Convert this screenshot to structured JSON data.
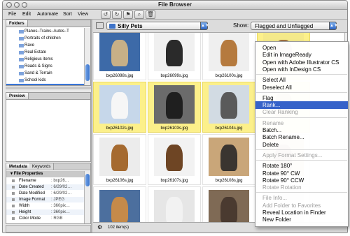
{
  "window": {
    "title": "File Browser"
  },
  "menu": {
    "items": [
      "File",
      "Edit",
      "Automate",
      "Sort",
      "View"
    ]
  },
  "toolbar": {
    "rotate_ccw": "↺",
    "rotate_cw": "↻",
    "flag": "⚑",
    "search": "⌕",
    "delete": "🗑"
  },
  "location": {
    "current_folder": "Silly Pets",
    "show_label": "Show:",
    "show_value": "Flagged and Unflagged"
  },
  "panels": {
    "folders_tab": "Folders",
    "preview_tab": "Preview",
    "metadata_tab": "Metadata",
    "keywords_tab": "Keywords"
  },
  "folder_tree": [
    {
      "label": "Planes–Trains–Autos–T",
      "selected": false
    },
    {
      "label": "Portraits of children",
      "selected": false
    },
    {
      "label": "Rave",
      "selected": false
    },
    {
      "label": "Real Estate",
      "selected": false
    },
    {
      "label": "Religious items",
      "selected": false
    },
    {
      "label": "Roads & Signs",
      "selected": false
    },
    {
      "label": "Sand & Terrain",
      "selected": false
    },
    {
      "label": "School kids",
      "selected": false
    },
    {
      "label": "Silly Pets",
      "selected": true
    }
  ],
  "metadata": {
    "section": "File Properties",
    "rows": [
      {
        "key": "Filename",
        "value": ": bxp26…"
      },
      {
        "key": "Date Created",
        "value": ": 6/29/02…"
      },
      {
        "key": "Date Modified",
        "value": ": 6/29/02…"
      },
      {
        "key": "Image Format",
        "value": ": JPEG"
      },
      {
        "key": "Width",
        "value": ": 360pix…"
      },
      {
        "key": "Height",
        "value": ": 360pix…"
      },
      {
        "key": "Color Mode",
        "value": ": RGB"
      }
    ]
  },
  "thumbnails": [
    {
      "caption": "bxp26098s.jpg",
      "flagged": false,
      "bg": "#3d6aa8",
      "subject": "#c7b087"
    },
    {
      "caption": "bxp26099s.jpg",
      "flagged": false,
      "bg": "#f0f0f0",
      "subject": "#2a2a2a"
    },
    {
      "caption": "bxp26100s.jpg",
      "flagged": false,
      "bg": "#efefef",
      "subject": "#b57a3e"
    },
    {
      "caption": "",
      "flagged": true,
      "bg": "#f4e98a",
      "subject": "#a07040"
    },
    {
      "caption": "bxp26102s.jpg",
      "flagged": true,
      "bg": "#c6d7ea",
      "subject": "#f6f6f6"
    },
    {
      "caption": "bxp26103s.jpg",
      "flagged": true,
      "bg": "#6b6b6b",
      "subject": "#1f1f1f"
    },
    {
      "caption": "bxp26104s.jpg",
      "flagged": true,
      "bg": "#d2dbe3",
      "subject": "#5a5a5a"
    },
    {
      "caption": "",
      "flagged": true,
      "bg": "#f4e98a",
      "subject": "#c09050"
    },
    {
      "caption": "bxp26106s.jpg",
      "flagged": false,
      "bg": "#ececec",
      "subject": "#a56a30"
    },
    {
      "caption": "bxp26107s.jpg",
      "flagged": false,
      "bg": "#f2f2f2",
      "subject": "#6e4524"
    },
    {
      "caption": "bxp26108s.jpg",
      "flagged": false,
      "bg": "#c9a679",
      "subject": "#3a3530"
    },
    {
      "caption": "",
      "flagged": false,
      "bg": "#cbb089",
      "subject": "#7a5530"
    },
    {
      "caption": "",
      "flagged": false,
      "bg": "#4c6f9e",
      "subject": "#c58a4a"
    },
    {
      "caption": "",
      "flagged": false,
      "bg": "#e6e6e6",
      "subject": "#f2f2f2"
    },
    {
      "caption": "",
      "flagged": false,
      "bg": "#7f6a55",
      "subject": "#4a3a30"
    },
    {
      "caption": "",
      "flagged": false,
      "bg": "#e0e0e0",
      "subject": "#cfcfcf"
    }
  ],
  "status": {
    "count": "102 item(s)"
  },
  "context_menu": [
    {
      "label": "Open",
      "state": "enabled"
    },
    {
      "label": "Edit in ImageReady",
      "state": "enabled"
    },
    {
      "label": "Open with Adobe Illustrator CS",
      "state": "enabled"
    },
    {
      "label": "Open with InDesign CS",
      "state": "enabled"
    },
    {
      "sep": true
    },
    {
      "label": "Select All",
      "state": "enabled"
    },
    {
      "label": "Deselect All",
      "state": "enabled"
    },
    {
      "sep": true
    },
    {
      "label": "Flag",
      "state": "enabled"
    },
    {
      "label": "Rank...",
      "state": "highlighted"
    },
    {
      "label": "Clear Ranking",
      "state": "disabled"
    },
    {
      "sep": true
    },
    {
      "label": "Rename",
      "state": "disabled"
    },
    {
      "label": "Batch...",
      "state": "enabled"
    },
    {
      "label": "Batch Rename...",
      "state": "enabled"
    },
    {
      "label": "Delete",
      "state": "enabled"
    },
    {
      "sep": true
    },
    {
      "label": "Apply Format Settings...",
      "state": "disabled"
    },
    {
      "sep": true
    },
    {
      "label": "Rotate 180°",
      "state": "enabled"
    },
    {
      "label": "Rotate 90° CW",
      "state": "enabled"
    },
    {
      "label": "Rotate 90° CCW",
      "state": "enabled"
    },
    {
      "label": "Rotate Rotation",
      "state": "disabled"
    },
    {
      "sep": true
    },
    {
      "label": "File Info...",
      "state": "disabled"
    },
    {
      "label": "Add Folder to Favorites",
      "state": "disabled"
    },
    {
      "label": "Reveal Location in Finder",
      "state": "enabled"
    },
    {
      "label": "New Folder",
      "state": "enabled"
    }
  ],
  "colors": {
    "flag_highlight": "#fcf08a",
    "selection": "#3875d7",
    "menu_highlight": "#3562c9"
  }
}
